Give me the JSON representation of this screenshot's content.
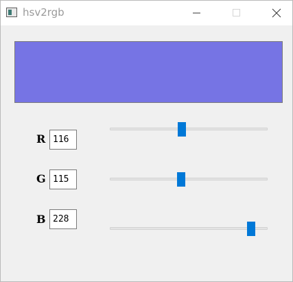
{
  "window": {
    "title": "hsv2rgb",
    "icons": {
      "app": "app-window-icon",
      "minimize": "minimize-icon",
      "maximize": "maximize-icon",
      "close": "close-icon"
    }
  },
  "preview": {
    "color": "#7674e4"
  },
  "channels": [
    {
      "label": "R",
      "value": "116",
      "slider_fraction": 0.455
    },
    {
      "label": "G",
      "value": "115",
      "slider_fraction": 0.451
    },
    {
      "label": "B",
      "value": "228",
      "slider_fraction": 0.894
    }
  ],
  "colors": {
    "slider_thumb": "#0078d7",
    "window_bg": "#f0f0f0"
  }
}
